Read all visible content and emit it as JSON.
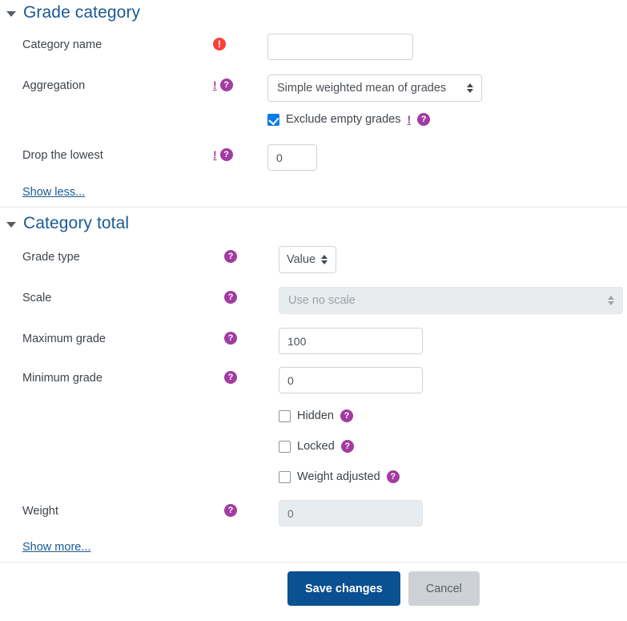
{
  "colors": {
    "heading": "#1a5a94",
    "required_icon": "#f9423a",
    "help_icon": "#a23ba2",
    "advanced_flag": "#a23ba2",
    "checkbox_checked": "#0a7ce8",
    "primary_button": "#0b5091",
    "cancel_button": "#ced2d6",
    "disabled_field": "#e9ecef",
    "link": "#1a5a94"
  },
  "icons": {
    "collapse": "caret-down-icon",
    "required": "required-exclamation-icon",
    "help": "help-question-icon",
    "advanced": "advanced-exclamation-icon",
    "select_arrows": "chevron-updown-icon"
  },
  "sections": [
    {
      "id": "grade-category",
      "title": "Grade category",
      "collapsed": false,
      "fields": [
        {
          "id": "category-name",
          "label": "Category name",
          "type": "text",
          "value": "",
          "placeholder": "",
          "required": true,
          "advanced": false,
          "help": false
        },
        {
          "id": "aggregation",
          "label": "Aggregation",
          "type": "select",
          "value": "Simple weighted mean of grades",
          "required": false,
          "advanced": true,
          "help": true
        },
        {
          "id": "exclude-empty-grades",
          "label": "Exclude empty grades",
          "type": "checkbox",
          "checked": true,
          "advanced": true,
          "help": true
        },
        {
          "id": "drop-the-lowest",
          "label": "Drop the lowest",
          "type": "text",
          "value": "0",
          "placeholder": "",
          "required": false,
          "advanced": true,
          "help": true
        }
      ],
      "toggle_link": "Show less..."
    },
    {
      "id": "category-total",
      "title": "Category total",
      "collapsed": false,
      "fields": [
        {
          "id": "grade-type",
          "label": "Grade type",
          "type": "select",
          "value": "Value",
          "help": true,
          "disabled": false
        },
        {
          "id": "scale",
          "label": "Scale",
          "type": "select",
          "value": "Use no scale",
          "help": true,
          "disabled": true
        },
        {
          "id": "maximum-grade",
          "label": "Maximum grade",
          "type": "text",
          "value": "100",
          "placeholder": "",
          "help": true,
          "disabled": false
        },
        {
          "id": "minimum-grade",
          "label": "Minimum grade",
          "type": "text",
          "value": "0",
          "placeholder": "",
          "help": true,
          "disabled": false
        },
        {
          "id": "hidden",
          "label": "Hidden",
          "type": "checkbox",
          "checked": false,
          "help": true
        },
        {
          "id": "locked",
          "label": "Locked",
          "type": "checkbox",
          "checked": false,
          "help": true
        },
        {
          "id": "weight-adjusted",
          "label": "Weight adjusted",
          "type": "checkbox",
          "checked": false,
          "help": true
        },
        {
          "id": "weight",
          "label": "Weight",
          "type": "text",
          "value": "0",
          "placeholder": "",
          "help": true,
          "disabled": true
        }
      ],
      "toggle_link": "Show more..."
    }
  ],
  "actions": {
    "save_label": "Save changes",
    "cancel_label": "Cancel"
  }
}
